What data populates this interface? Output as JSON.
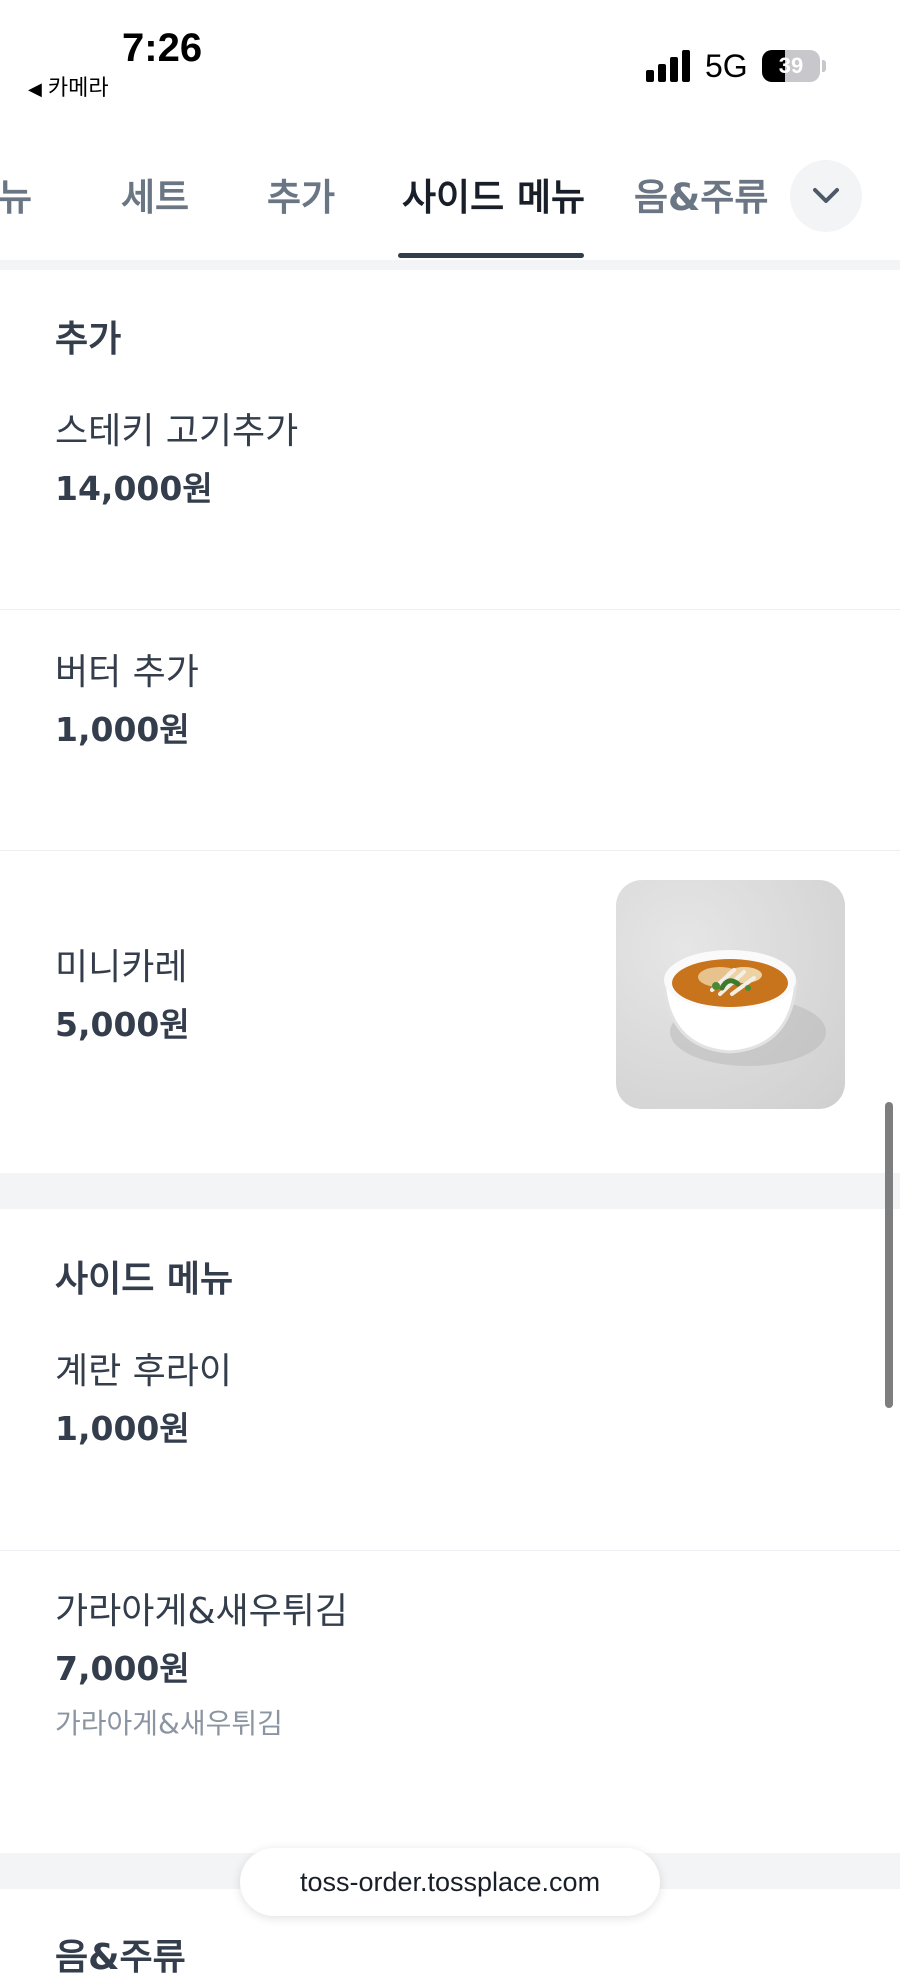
{
  "status_bar": {
    "time": "7:26",
    "back_label": "카메라",
    "network": "5G",
    "battery": "39",
    "battery_level": 0.39
  },
  "tabs": [
    {
      "label": "메뉴",
      "active": false
    },
    {
      "label": "세트",
      "active": false
    },
    {
      "label": "추가",
      "active": false
    },
    {
      "label": "사이드 메뉴",
      "active": true
    },
    {
      "label": "음&주류",
      "active": false
    }
  ],
  "sections": [
    {
      "title": "추가",
      "items": [
        {
          "name": "스테키 고기추가",
          "price": "14,000원"
        },
        {
          "name": "버터 추가",
          "price": "1,000원"
        },
        {
          "name": "미니카레",
          "price": "5,000원",
          "image": "curry-soup-bowl"
        }
      ]
    },
    {
      "title": "사이드 메뉴",
      "items": [
        {
          "name": "계란 후라이",
          "price": "1,000원"
        },
        {
          "name": "가라아게&새우튀김",
          "price": "7,000원",
          "description": "가라아게&새우튀김"
        }
      ]
    },
    {
      "title": "음&주류"
    }
  ],
  "browser": {
    "url": "toss-order.tossplace.com"
  },
  "icons": {
    "more_tabs": "chevron-down-icon",
    "back": "back-arrow-icon"
  }
}
